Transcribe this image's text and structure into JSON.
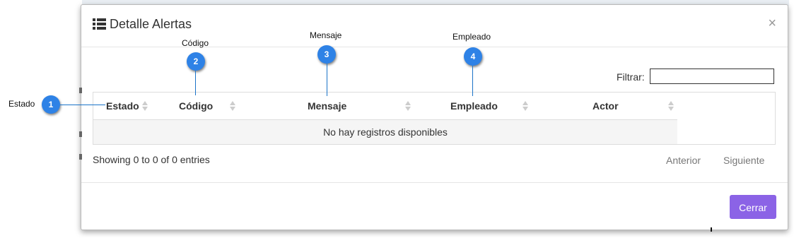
{
  "modal": {
    "title": "Detalle Alertas",
    "close_glyph": "×",
    "title_icon": "list-icon"
  },
  "filter": {
    "label": "Filtrar:",
    "value": ""
  },
  "table": {
    "columns": [
      "Estado",
      "Código",
      "Mensaje",
      "Empleado",
      "Actor"
    ],
    "empty_message": "No hay registros disponibles"
  },
  "info_text": "Showing 0 to 0 of 0 entries",
  "pagination": {
    "previous": "Anterior",
    "next": "Siguiente"
  },
  "footer": {
    "close_button": "Cerrar"
  },
  "callouts": [
    {
      "number": "1",
      "label": "Estado"
    },
    {
      "number": "2",
      "label": "Código"
    },
    {
      "number": "3",
      "label": "Mensaje"
    },
    {
      "number": "4",
      "label": "Empleado"
    }
  ],
  "colors": {
    "accent": "#8b63e6",
    "callout": "#2e82e6"
  }
}
